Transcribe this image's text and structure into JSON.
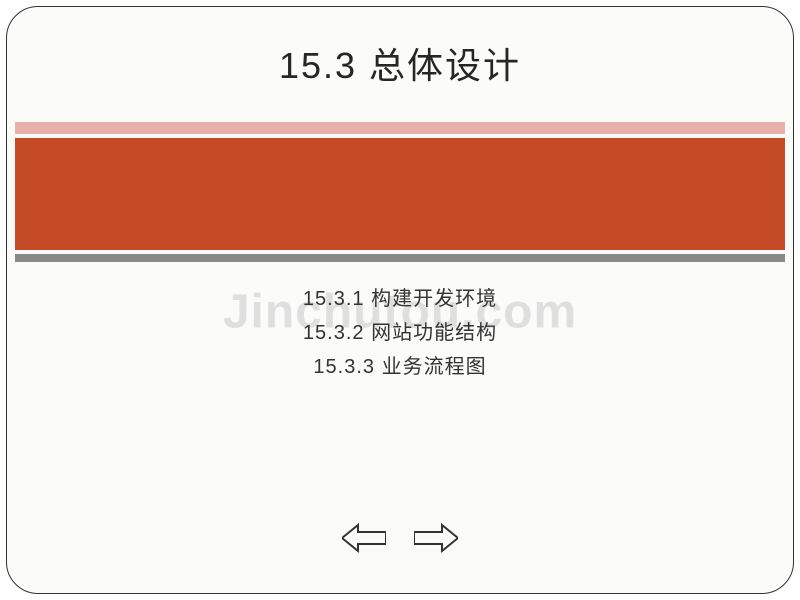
{
  "slide": {
    "title": "15.3  总体设计",
    "items": [
      "15.3.1  构建开发环境",
      "15.3.2  网站功能结构",
      "15.3.3  业务流程图"
    ]
  },
  "watermark": "Jinchutou.com",
  "nav": {
    "prev": "previous",
    "next": "next"
  }
}
